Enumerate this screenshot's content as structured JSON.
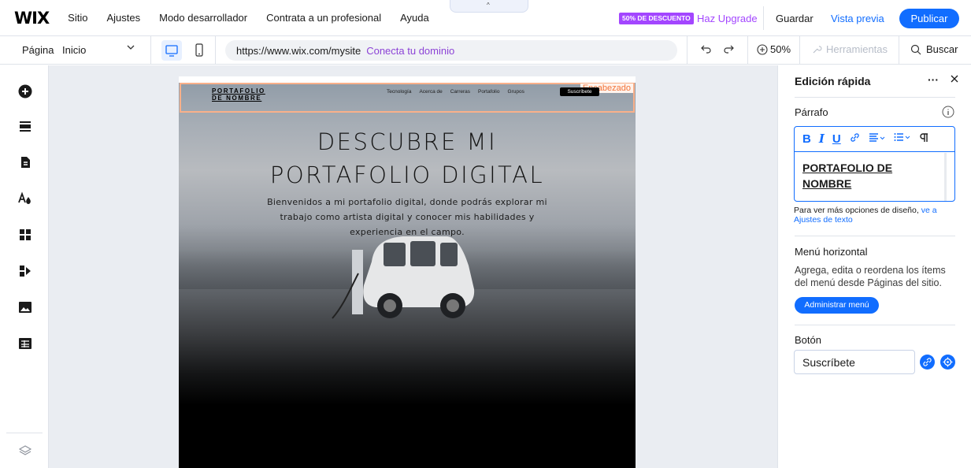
{
  "topbar": {
    "logo": "WIX",
    "menu": [
      "Sitio",
      "Ajustes",
      "Modo desarrollador",
      "Contrata a un profesional",
      "Ayuda"
    ],
    "discount_badge": "50% DE DESCUENTO",
    "upgrade": "Haz Upgrade",
    "save": "Guardar",
    "preview": "Vista previa",
    "publish": "Publicar"
  },
  "toolbar": {
    "page_label": "Página",
    "page_value": "Inicio",
    "url": "https://www.wix.com/mysite",
    "connect_domain": "Conecta tu dominio",
    "zoom": "50%",
    "tools": "Herramientas",
    "search": "Buscar"
  },
  "sidebar": {
    "icons": [
      "add-icon",
      "sections-icon",
      "pages-icon",
      "design-icon",
      "apps-icon",
      "business-icon",
      "media-icon",
      "table-icon"
    ],
    "bottom_icon": "layers-icon"
  },
  "site": {
    "header_tag": "Encabezado",
    "logo_line1": "PORTAFOLIO",
    "logo_line2": "DE NOMBRE",
    "nav": [
      "Tecnología",
      "Acerca de",
      "Carreras",
      "Portafolio",
      "Grupos"
    ],
    "subscribe": "Suscríbete",
    "title_line1": "DESCUBRE MI",
    "title_line2": "PORTAFOLIO DIGITAL",
    "body": "Bienvenidos a mi portafolio digital, donde podrás explorar mi trabajo como artista digital y conocer mis habilidades y experiencia en el campo."
  },
  "panel": {
    "title": "Edición rápida",
    "more": "···",
    "paragraph_label": "Párrafo",
    "editor_text_line1": "PORTAFOLIO DE",
    "editor_text_line2": "NOMBRE",
    "more_options_text": "Para ver más opciones de diseño,",
    "more_options_link": "ve a Ajustes de texto",
    "menu_label": "Menú horizontal",
    "menu_desc": "Agrega, edita o reordena los ítems del menú desde Páginas del sitio.",
    "manage_menu": "Administrar menú",
    "button_label": "Botón",
    "button_value": "Suscríbete"
  },
  "colors": {
    "accent": "#116dff",
    "premium": "#a346ff",
    "header_highlight": "#f9b08a"
  }
}
